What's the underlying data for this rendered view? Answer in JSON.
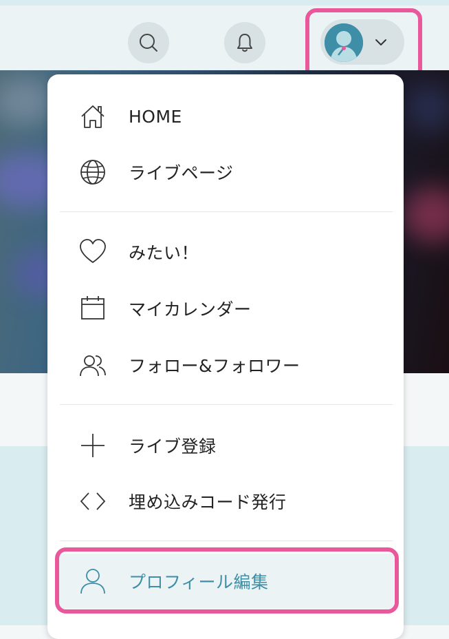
{
  "header": {
    "search_icon": "search-icon",
    "bell_icon": "bell-icon",
    "user_avatar_icon": "user-avatar-icon",
    "chevron_icon": "chevron-down-icon"
  },
  "menu": {
    "groups": [
      [
        {
          "label": "HOME",
          "icon": "home-icon"
        },
        {
          "label": "ライブページ",
          "icon": "globe-icon"
        }
      ],
      [
        {
          "label": "みたい！",
          "icon": "heart-icon"
        },
        {
          "label": "マイカレンダー",
          "icon": "calendar-icon"
        },
        {
          "label": "フォロー&フォロワー",
          "icon": "users-icon"
        }
      ],
      [
        {
          "label": "ライブ登録",
          "icon": "plus-icon"
        },
        {
          "label": "埋め込みコード発行",
          "icon": "code-icon"
        }
      ],
      [
        {
          "label": "プロフィール編集",
          "icon": "user-icon",
          "active": true
        }
      ]
    ]
  },
  "colors": {
    "accent": "#3d8ea6",
    "highlight": "#e8589b",
    "header_bg": "#ebf3f5",
    "button_bg": "#d8e2e5"
  }
}
